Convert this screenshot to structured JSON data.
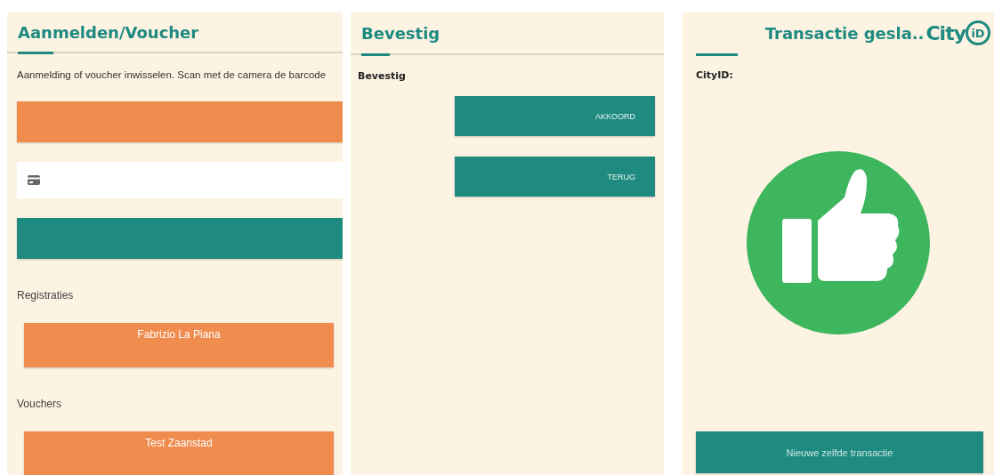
{
  "screens": [
    {
      "kind": "login",
      "title": "Aanmelden/Voucher",
      "description": "Aanmelding of voucher inwisselen. Scan met de camera de barcode",
      "sections": [
        {
          "heading": "Registraties",
          "items": [
            "Fabrizio La Piana"
          ]
        },
        {
          "heading": "Vouchers",
          "items": [
            "Test Zaanstad"
          ]
        }
      ]
    },
    {
      "kind": "confirm",
      "title": "Bevestig",
      "subtitle": "Bevestig",
      "buttons": [
        "AKKOORD",
        "TERUG"
      ]
    },
    {
      "kind": "result",
      "title": "Transactie gesla..",
      "logo": {
        "word": "City",
        "badge": "iD"
      },
      "label": "CityID:",
      "button": "Nieuwe zelfde transactie"
    }
  ]
}
